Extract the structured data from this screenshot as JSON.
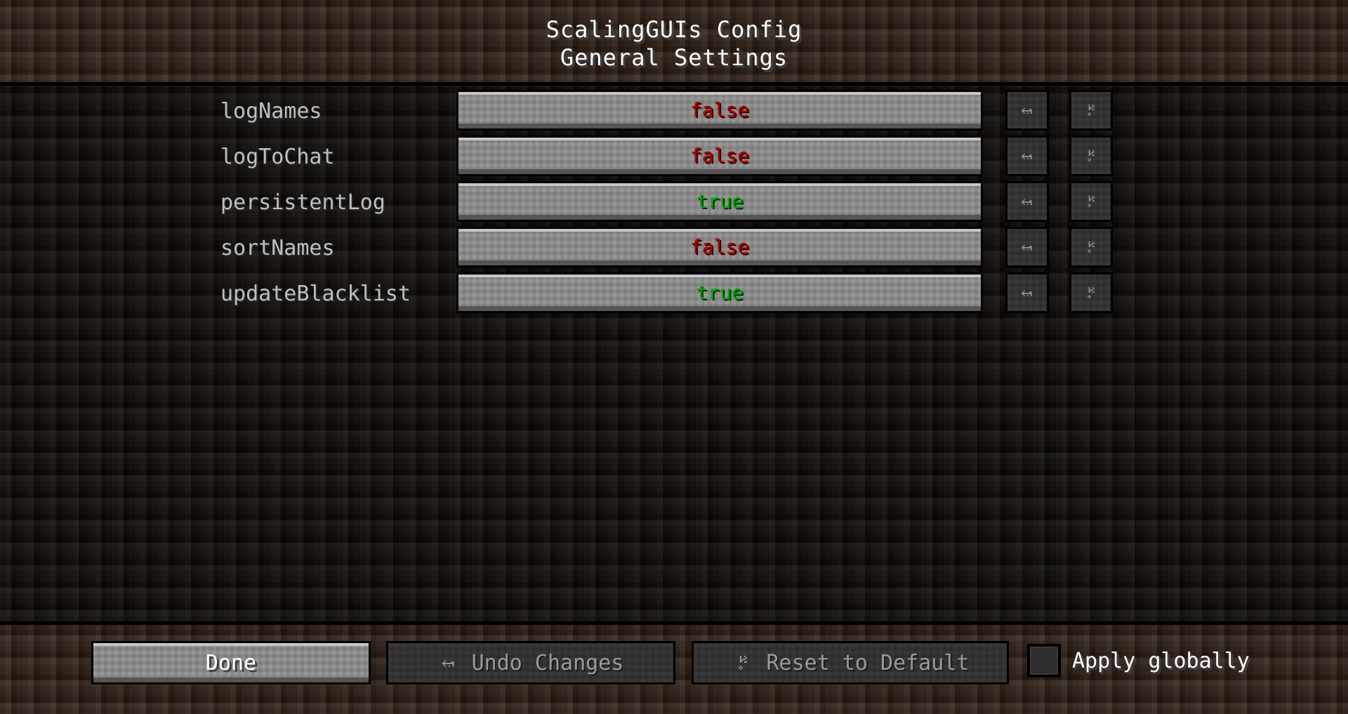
{
  "header": {
    "title": "ScalingGUIs Config",
    "subtitle": "General Settings"
  },
  "colors": {
    "true_value": "#00aa00",
    "false_value": "#aa0000",
    "label": "#bfbfbf",
    "button_face": "#8b8b8b",
    "dirt": "#2b1d13",
    "body": "#0c0906"
  },
  "options": [
    {
      "label": "logNames",
      "value": "false",
      "state": "false",
      "undo_icon": "undo-arrow-icon",
      "reset_icon": "reset-broom-icon"
    },
    {
      "label": "logToChat",
      "value": "false",
      "state": "false",
      "undo_icon": "undo-arrow-icon",
      "reset_icon": "reset-broom-icon"
    },
    {
      "label": "persistentLog",
      "value": "true",
      "state": "true",
      "undo_icon": "undo-arrow-icon",
      "reset_icon": "reset-broom-icon"
    },
    {
      "label": "sortNames",
      "value": "false",
      "state": "false",
      "undo_icon": "undo-arrow-icon",
      "reset_icon": "reset-broom-icon"
    },
    {
      "label": "updateBlacklist",
      "value": "true",
      "state": "true",
      "undo_icon": "undo-arrow-icon",
      "reset_icon": "reset-broom-icon"
    }
  ],
  "footer": {
    "done_label": "Done",
    "undo_label": "Undo Changes",
    "undo_icon": "undo-arrow-icon",
    "reset_label": "Reset to Default",
    "reset_icon": "reset-broom-icon",
    "apply_globally_label": "Apply globally",
    "apply_globally_checked": false
  }
}
